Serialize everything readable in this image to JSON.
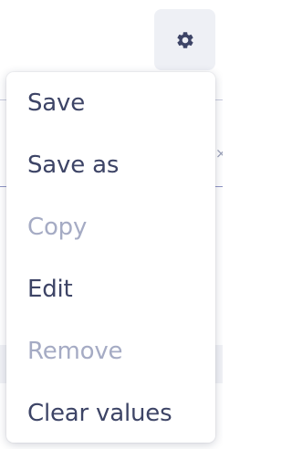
{
  "colors": {
    "text": "#3d4466",
    "disabled_text": "#a5abc4",
    "gear_button_bg": "#eef0f5",
    "gear_icon": "#3d4466"
  },
  "background": {
    "close_glyph": "×"
  },
  "settings_button": {
    "icon": "gear-icon"
  },
  "menu": {
    "items": [
      {
        "label": "Save",
        "enabled": true
      },
      {
        "label": "Save as",
        "enabled": true
      },
      {
        "label": "Copy",
        "enabled": false
      },
      {
        "label": "Edit",
        "enabled": true
      },
      {
        "label": "Remove",
        "enabled": false
      },
      {
        "label": "Clear values",
        "enabled": true
      }
    ]
  }
}
